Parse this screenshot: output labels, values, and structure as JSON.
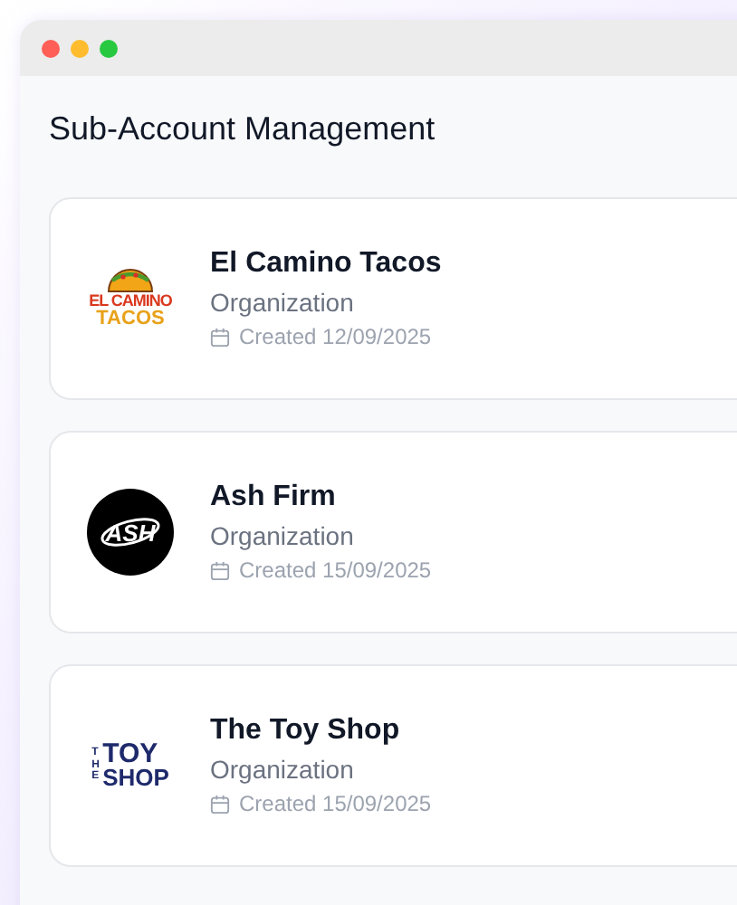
{
  "window": {
    "title": "Sub-Account Management"
  },
  "accounts": [
    {
      "name": "El Camino Tacos",
      "type": "Organization",
      "created": "Created 12/09/2025",
      "logo": {
        "kind": "taco",
        "lines": [
          "EL CAMINO",
          "TACOS"
        ]
      }
    },
    {
      "name": "Ash Firm",
      "type": "Organization",
      "created": "Created 15/09/2025",
      "logo": {
        "kind": "circle",
        "lines": [
          "ASH"
        ]
      }
    },
    {
      "name": "The Toy Shop",
      "type": "Organization",
      "created": "Created 15/09/2025",
      "logo": {
        "kind": "toy",
        "lines": [
          "THE",
          "TOY",
          "SHOP"
        ]
      }
    }
  ]
}
